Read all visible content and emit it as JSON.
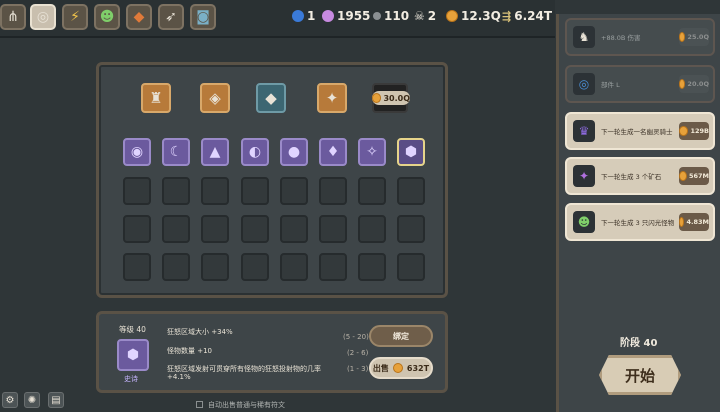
{
  "resources": {
    "blue": "1",
    "purple": "1955",
    "grey": "110",
    "skull": "2",
    "gold": "12.3Q",
    "arrows": "6.24T"
  },
  "shop": {
    "price": "30.0Q"
  },
  "info": {
    "level": "等级 40",
    "rarity": "史诗",
    "line1": "狂怒区域大小 +34%",
    "line2": "怪物数量 +10",
    "line3": "狂怒区域发射可贯穿所有怪物的狂怒投射物的几率",
    "line4": "+4.1%",
    "range1": "(5 - 20)",
    "range2": "(2 - 6)",
    "range3": "(1 - 3)",
    "bind_label": "绑定",
    "sell_label": "出售",
    "sell_price": "632T"
  },
  "sidebar": {
    "cards": [
      {
        "text": "+88.0B 伤害",
        "cost": "25.0Q",
        "state": "dim"
      },
      {
        "text": "部件 L",
        "cost": "20.0Q",
        "state": "dim"
      },
      {
        "text": "下一轮生成一名幽灵骑士",
        "cost": "129B",
        "state": "lit"
      },
      {
        "text": "下一轮生成 3 个矿石",
        "cost": "567M",
        "state": "lit"
      },
      {
        "text": "下一轮生成 3 只闪光怪物",
        "cost": "4.83M",
        "state": "lit"
      }
    ],
    "stage": "阶段 40",
    "start_label": "开始"
  },
  "footer": {
    "auto_sell": "自动出售普通与稀有符文"
  },
  "colors": {
    "accent_gold": "#e7a13a",
    "panel_border": "#5a5246",
    "gem_purple": "#6b5a9e"
  }
}
